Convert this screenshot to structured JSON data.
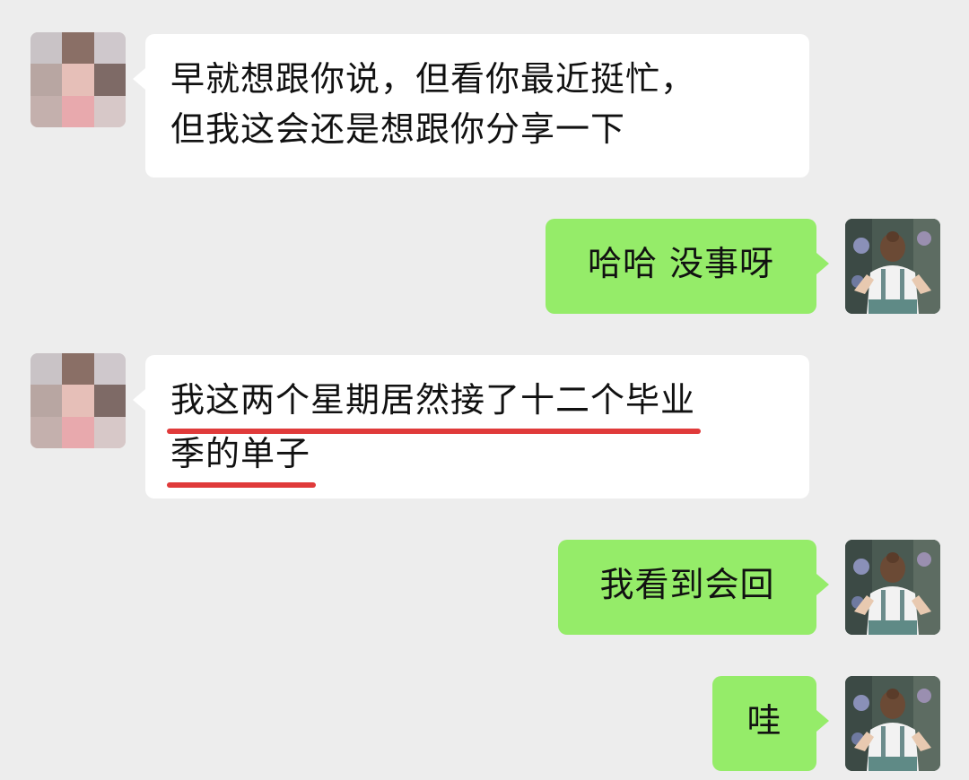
{
  "conversation": {
    "messages": [
      {
        "id": "m1",
        "direction": "incoming",
        "avatar": "blurred-contact-avatar",
        "lines": [
          "早就想跟你说，但看你最近挺忙，",
          "但我这会还是想跟你分享一下"
        ],
        "underlined": false
      },
      {
        "id": "m2",
        "direction": "outgoing",
        "avatar": "user-avatar-girl-back-view",
        "lines": [
          "哈哈 没事呀"
        ],
        "underlined": false
      },
      {
        "id": "m3",
        "direction": "incoming",
        "avatar": "blurred-contact-avatar",
        "lines": [
          "我这两个星期居然接了十二个毕业",
          "季的单子"
        ],
        "underlined": true,
        "underline_color": "#e03a3a"
      },
      {
        "id": "m4",
        "direction": "outgoing",
        "avatar": "user-avatar-girl-back-view",
        "lines": [
          "我看到会回"
        ],
        "underlined": false
      },
      {
        "id": "m5",
        "direction": "outgoing",
        "avatar": "user-avatar-girl-back-view",
        "lines": [
          "哇"
        ],
        "underlined": false
      }
    ]
  },
  "colors": {
    "background": "#ededed",
    "incoming_bubble": "#ffffff",
    "outgoing_bubble": "#95ec69",
    "annotation_underline": "#e03a3a"
  }
}
